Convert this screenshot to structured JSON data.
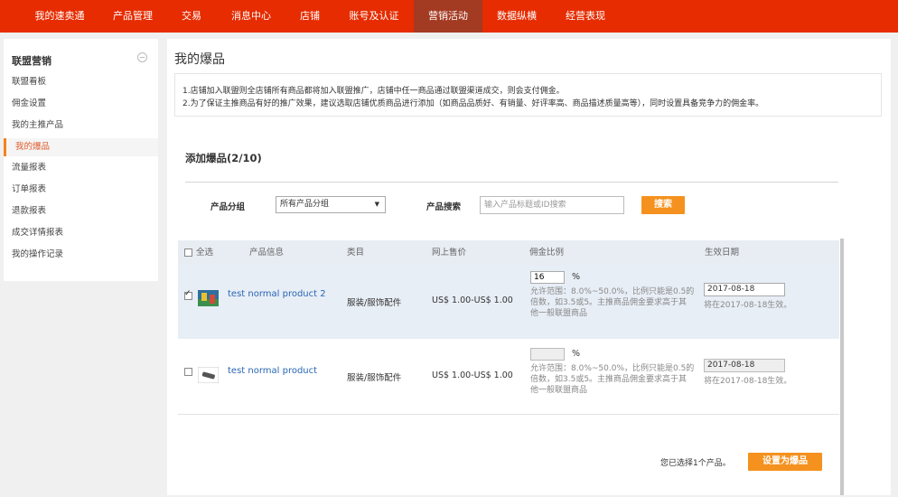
{
  "nav": {
    "items": [
      {
        "label": "我的速卖通"
      },
      {
        "label": "产品管理"
      },
      {
        "label": "交易"
      },
      {
        "label": "消息中心"
      },
      {
        "label": "店铺"
      },
      {
        "label": "账号及认证"
      },
      {
        "label": "营销活动",
        "active": true
      },
      {
        "label": "数据纵横"
      },
      {
        "label": "经营表现"
      }
    ]
  },
  "sidebar": {
    "title": "联盟营销",
    "collapse_symbol": "−",
    "items": [
      {
        "label": "联盟看板"
      },
      {
        "label": "佣金设置"
      },
      {
        "label": "我的主推产品"
      },
      {
        "label": "我的爆品",
        "active": true
      },
      {
        "label": "流量报表"
      },
      {
        "label": "订单报表"
      },
      {
        "label": "退款报表"
      },
      {
        "label": "成交详情报表"
      },
      {
        "label": "我的操作记录"
      }
    ]
  },
  "page": {
    "title": "我的爆品",
    "notice_line1": "1.店铺加入联盟则全店铺所有商品都将加入联盟推广，店铺中任一商品通过联盟渠道成交，则会支付佣金。",
    "notice_line2": "2.为了保证主推商品有好的推广效果，建议选取店铺优质商品进行添加（如商品品质好、有销量、好评率高、商品描述质量高等），同时设置具备竞争力的佣金率。",
    "section_title": "添加爆品(2/10)"
  },
  "filter": {
    "group_label": "产品分组",
    "group_selected": "所有产品分组",
    "search_label": "产品搜索",
    "search_placeholder": "输入产品标题或ID搜索",
    "search_button": "搜索"
  },
  "table": {
    "headers": {
      "select_all": "全选",
      "product_info": "产品信息",
      "category": "类目",
      "price": "网上售价",
      "commission": "佣金比例",
      "effective_date": "生效日期"
    },
    "rows": [
      {
        "checked": true,
        "name": "test normal product 2",
        "category": "服装/服饰配件",
        "price": "US$ 1.00-US$ 1.00",
        "rate": "16",
        "pct": "%",
        "hint": "允许范围：8.0%~50.0%，比例只能是0.5的倍数，如3.5或5。主推商品佣金要求高于其他一般联盟商品",
        "date": "2017-08-18",
        "date_note": "将在2017-08-18生效。",
        "enabled": true
      },
      {
        "checked": false,
        "name": "test normal product",
        "category": "服装/服饰配件",
        "price": "US$ 1.00-US$ 1.00",
        "rate": "",
        "pct": "%",
        "hint": "允许范围：8.0%~50.0%，比例只能是0.5的倍数，如3.5或5。主推商品佣金要求高于其他一般联盟商品",
        "date": "2017-08-18",
        "date_note": "将在2017-08-18生效。",
        "enabled": false
      }
    ]
  },
  "footer": {
    "selected_note": "您已选择1个产品。",
    "set_button": "设置为爆品"
  },
  "colors": {
    "nav_bg": "#e62c00",
    "nav_active": "#a33a22",
    "button_orange": "#f5911e",
    "link_blue": "#2a66b3"
  }
}
